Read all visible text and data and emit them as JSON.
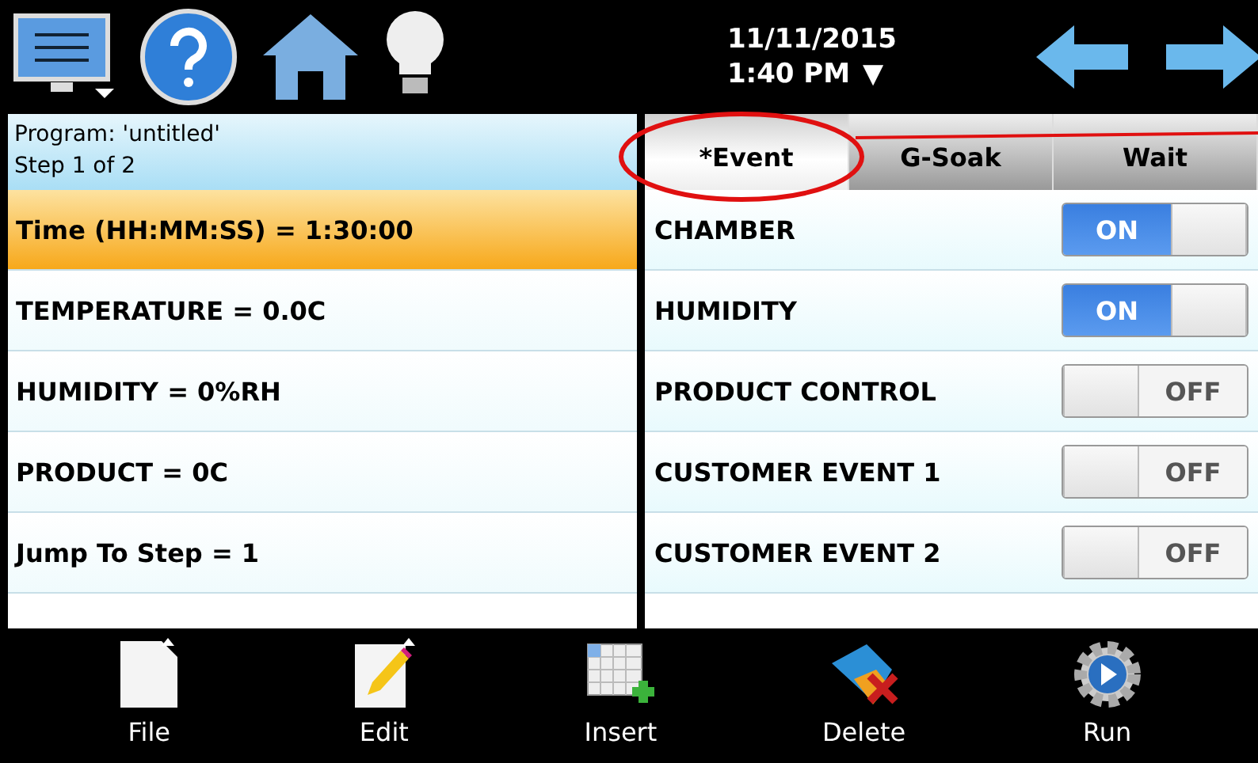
{
  "topbar": {
    "date": "11/11/2015",
    "time": "1:40 PM",
    "time_menu": "▼"
  },
  "program": {
    "title": "Program: 'untitled'",
    "step": "Step 1 of 2"
  },
  "steps": [
    {
      "label": "Time (HH:MM:SS) = 1:30:00",
      "selected": true
    },
    {
      "label": "TEMPERATURE = 0.0C",
      "selected": false
    },
    {
      "label": "HUMIDITY = 0%RH",
      "selected": false
    },
    {
      "label": "PRODUCT = 0C",
      "selected": false
    },
    {
      "label": "Jump To Step = 1",
      "selected": false
    }
  ],
  "tabs": [
    {
      "label": "*Event",
      "selected": true
    },
    {
      "label": "G-Soak",
      "selected": false
    },
    {
      "label": "Wait",
      "selected": false
    }
  ],
  "events": [
    {
      "name": "CHAMBER",
      "on": true,
      "label": "ON"
    },
    {
      "name": "HUMIDITY",
      "on": true,
      "label": "ON"
    },
    {
      "name": "PRODUCT CONTROL",
      "on": false,
      "label": "OFF"
    },
    {
      "name": "CUSTOMER EVENT 1",
      "on": false,
      "label": "OFF"
    },
    {
      "name": "CUSTOMER EVENT 2",
      "on": false,
      "label": "OFF"
    }
  ],
  "toolbar": [
    {
      "label": "File",
      "kind": "file"
    },
    {
      "label": "Edit",
      "kind": "edit"
    },
    {
      "label": "Insert",
      "kind": "insert"
    },
    {
      "label": "Delete",
      "kind": "delete"
    },
    {
      "label": "Run",
      "kind": "run"
    }
  ]
}
